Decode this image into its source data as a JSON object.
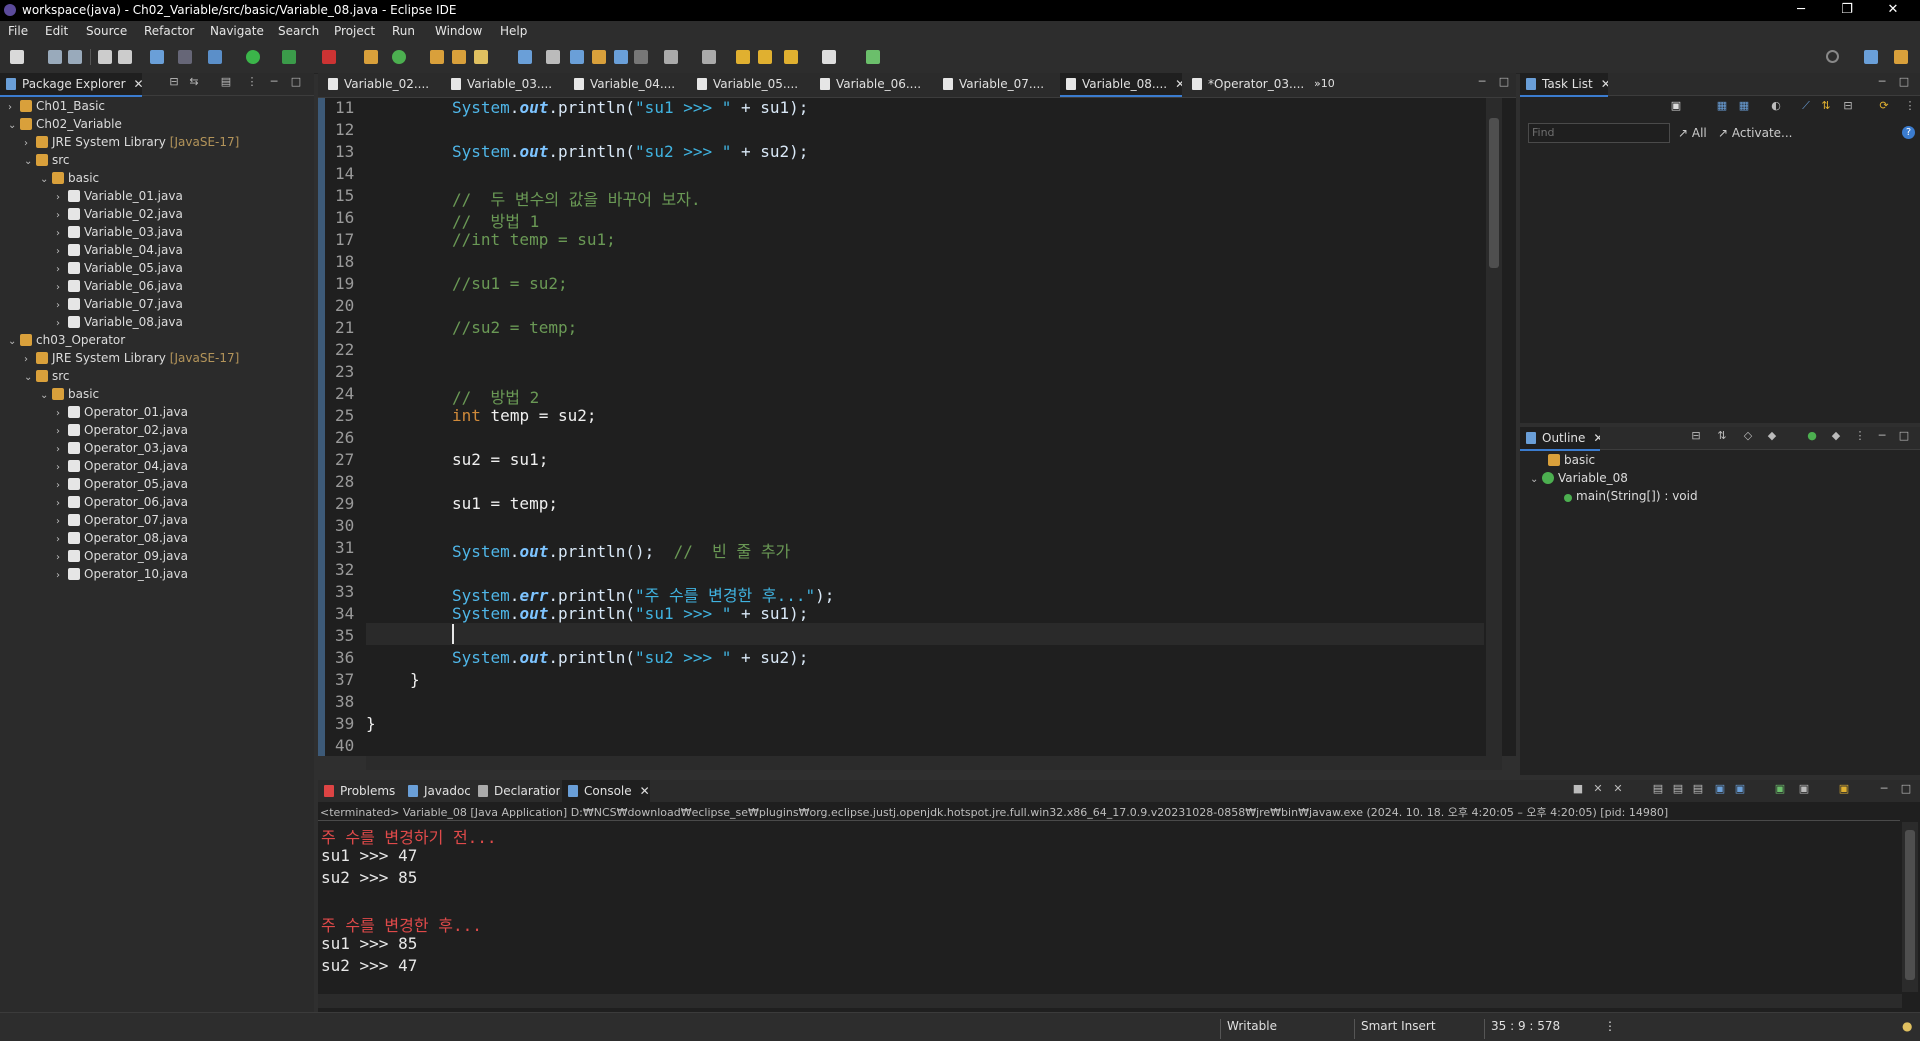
{
  "window": {
    "title": "workspace(java) - Ch02_Variable/src/basic/Variable_08.java - Eclipse IDE",
    "minimize": "─",
    "maximize": "❐",
    "close": "✕"
  },
  "menu": [
    "File",
    "Edit",
    "Source",
    "Refactor",
    "Navigate",
    "Search",
    "Project",
    "Run",
    "Window",
    "Help"
  ],
  "package_explorer": {
    "title": "Package Explorer",
    "tree": [
      {
        "label": "Ch01_Basic",
        "arrow": "›"
      },
      {
        "label": "Ch02_Variable",
        "arrow": "⌄"
      },
      {
        "label": "JRE System Library",
        "suffix": "[JavaSE-17]",
        "arrow": "›"
      },
      {
        "label": "src",
        "arrow": "⌄"
      },
      {
        "label": "basic",
        "arrow": "⌄"
      },
      {
        "label": "Variable_01.java",
        "arrow": "›"
      },
      {
        "label": "Variable_02.java",
        "arrow": "›"
      },
      {
        "label": "Variable_03.java",
        "arrow": "›"
      },
      {
        "label": "Variable_04.java",
        "arrow": "›"
      },
      {
        "label": "Variable_05.java",
        "arrow": "›"
      },
      {
        "label": "Variable_06.java",
        "arrow": "›"
      },
      {
        "label": "Variable_07.java",
        "arrow": "›"
      },
      {
        "label": "Variable_08.java",
        "arrow": "›"
      },
      {
        "label": "ch03_Operator",
        "arrow": "⌄"
      },
      {
        "label": "JRE System Library",
        "suffix": "[JavaSE-17]",
        "arrow": "›"
      },
      {
        "label": "src",
        "arrow": "⌄"
      },
      {
        "label": "basic",
        "arrow": "⌄"
      },
      {
        "label": "Operator_01.java",
        "arrow": "›"
      },
      {
        "label": "Operator_02.java",
        "arrow": "›"
      },
      {
        "label": "Operator_03.java",
        "arrow": "›"
      },
      {
        "label": "Operator_04.java",
        "arrow": "›"
      },
      {
        "label": "Operator_05.java",
        "arrow": "›"
      },
      {
        "label": "Operator_06.java",
        "arrow": "›"
      },
      {
        "label": "Operator_07.java",
        "arrow": "›"
      },
      {
        "label": "Operator_08.java",
        "arrow": "›"
      },
      {
        "label": "Operator_09.java",
        "arrow": "›"
      },
      {
        "label": "Operator_10.java",
        "arrow": "›"
      }
    ]
  },
  "editor": {
    "tabs": [
      "Variable_02....",
      "Variable_03....",
      "Variable_04....",
      "Variable_05....",
      "Variable_06....",
      "Variable_07....",
      "Variable_08....",
      "*Operator_03...."
    ],
    "active_tab": 6,
    "overflow": "»10",
    "line_numbers": [
      "11",
      "12",
      "13",
      "14",
      "15",
      "16",
      "17",
      "18",
      "19",
      "20",
      "21",
      "22",
      "23",
      "24",
      "25",
      "26",
      "27",
      "28",
      "29",
      "30",
      "31",
      "32",
      "33",
      "34",
      "35",
      "36",
      "37",
      "38",
      "39",
      "40"
    ],
    "lines": {
      "l11": "System.out.println(\"su1 >>> \" + su1);",
      "l13": "System.out.println(\"su2 >>> \" + su2);",
      "l15": "//  두 변수의 값을 바꾸어 보자.",
      "l16": "//  방법 1",
      "l17": "//int temp = su1;",
      "l19": "//su1 = su2;",
      "l21": "//su2 = temp;",
      "l24": "//  방법 2",
      "l25": "int temp = su2;",
      "l27": "su2 = su1;",
      "l29": "su1 = temp;",
      "l31": "System.out.println();  //  빈 줄 추가",
      "l33": "System.err.println(\"주 수를 변경한 후...\");",
      "l34": "System.out.println(\"su1 >>> \" + su1);",
      "l36": "System.out.println(\"su2 >>> \" + su2);",
      "l37": "}",
      "l39": "}"
    }
  },
  "task_list": {
    "title": "Task List",
    "find_placeholder": "Find",
    "all": "All",
    "activate": "Activate..."
  },
  "outline": {
    "title": "Outline",
    "items": [
      "basic",
      "Variable_08",
      "main(String[]) : void"
    ]
  },
  "bottom_tabs": [
    "Problems",
    "Javadoc",
    "Declaration",
    "Console"
  ],
  "console": {
    "header": "<terminated> Variable_08 [Java Application] D:₩NCS₩download₩eclipse_se₩plugins₩org.eclipse.justj.openjdk.hotspot.jre.full.win32.x86_64_17.0.9.v20231028-0858₩jre₩bin₩javaw.exe  (2024. 10. 18. 오후 4:20:05 – 오후 4:20:05) [pid: 14980]",
    "lines": [
      {
        "text": "주 수를 변경하기 전...",
        "kind": "err"
      },
      {
        "text": "su1 >>> 47",
        "kind": "out"
      },
      {
        "text": "su2 >>> 85",
        "kind": "out"
      },
      {
        "text": "",
        "kind": "out"
      },
      {
        "text": "주 수를 변경한 후...",
        "kind": "err"
      },
      {
        "text": "su1 >>> 85",
        "kind": "out"
      },
      {
        "text": "su2 >>> 47",
        "kind": "out"
      }
    ]
  },
  "status": {
    "writable": "Writable",
    "insert_mode": "Smart Insert",
    "position": "35 : 9 : 578"
  },
  "colors": {
    "accent": "#3b7ccf",
    "error_text": "#e04a4a",
    "comment": "#6a9955",
    "keyword": "#d08a3a"
  }
}
